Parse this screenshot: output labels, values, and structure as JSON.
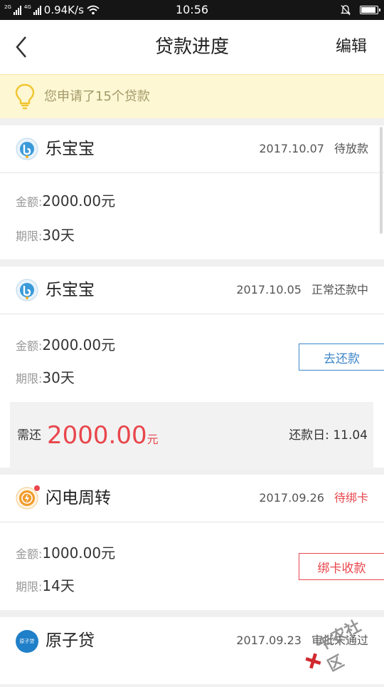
{
  "status_bar": {
    "network_left": "2G",
    "network_right": "4G",
    "speed": "0.94K/s",
    "time": "10:56",
    "battery_level": 0.85
  },
  "nav": {
    "title": "贷款进度",
    "edit_label": "编辑"
  },
  "notice": {
    "text": "您申请了15个贷款"
  },
  "loans": [
    {
      "name": "乐宝宝",
      "date": "2017.10.07",
      "status": "待放款",
      "amount_label": "金额:",
      "amount": "2000.00元",
      "term_label": "期限:",
      "term": "30天"
    },
    {
      "name": "乐宝宝",
      "date": "2017.10.05",
      "status": "正常还款中",
      "amount_label": "金额:",
      "amount": "2000.00元",
      "term_label": "期限:",
      "term": "30天",
      "action_label": "去还款",
      "due_label": "需还",
      "due_amount": "2000.00",
      "due_unit": "元",
      "due_date": "还款日: 11.04"
    },
    {
      "name": "闪电周转",
      "date": "2017.09.26",
      "status": "待绑卡",
      "amount_label": "金额:",
      "amount": "1000.00元",
      "term_label": "期限:",
      "term": "14天",
      "action_label": "绑卡收款"
    },
    {
      "name": "原子贷",
      "date": "2017.09.23",
      "status": "审批未通过",
      "logo_text": "原子贷"
    }
  ],
  "watermark": "卡农社区",
  "colors": {
    "accent_blue": "#3f86c9",
    "accent_red": "#e8464c",
    "notice_bg": "#fdf7d3"
  }
}
